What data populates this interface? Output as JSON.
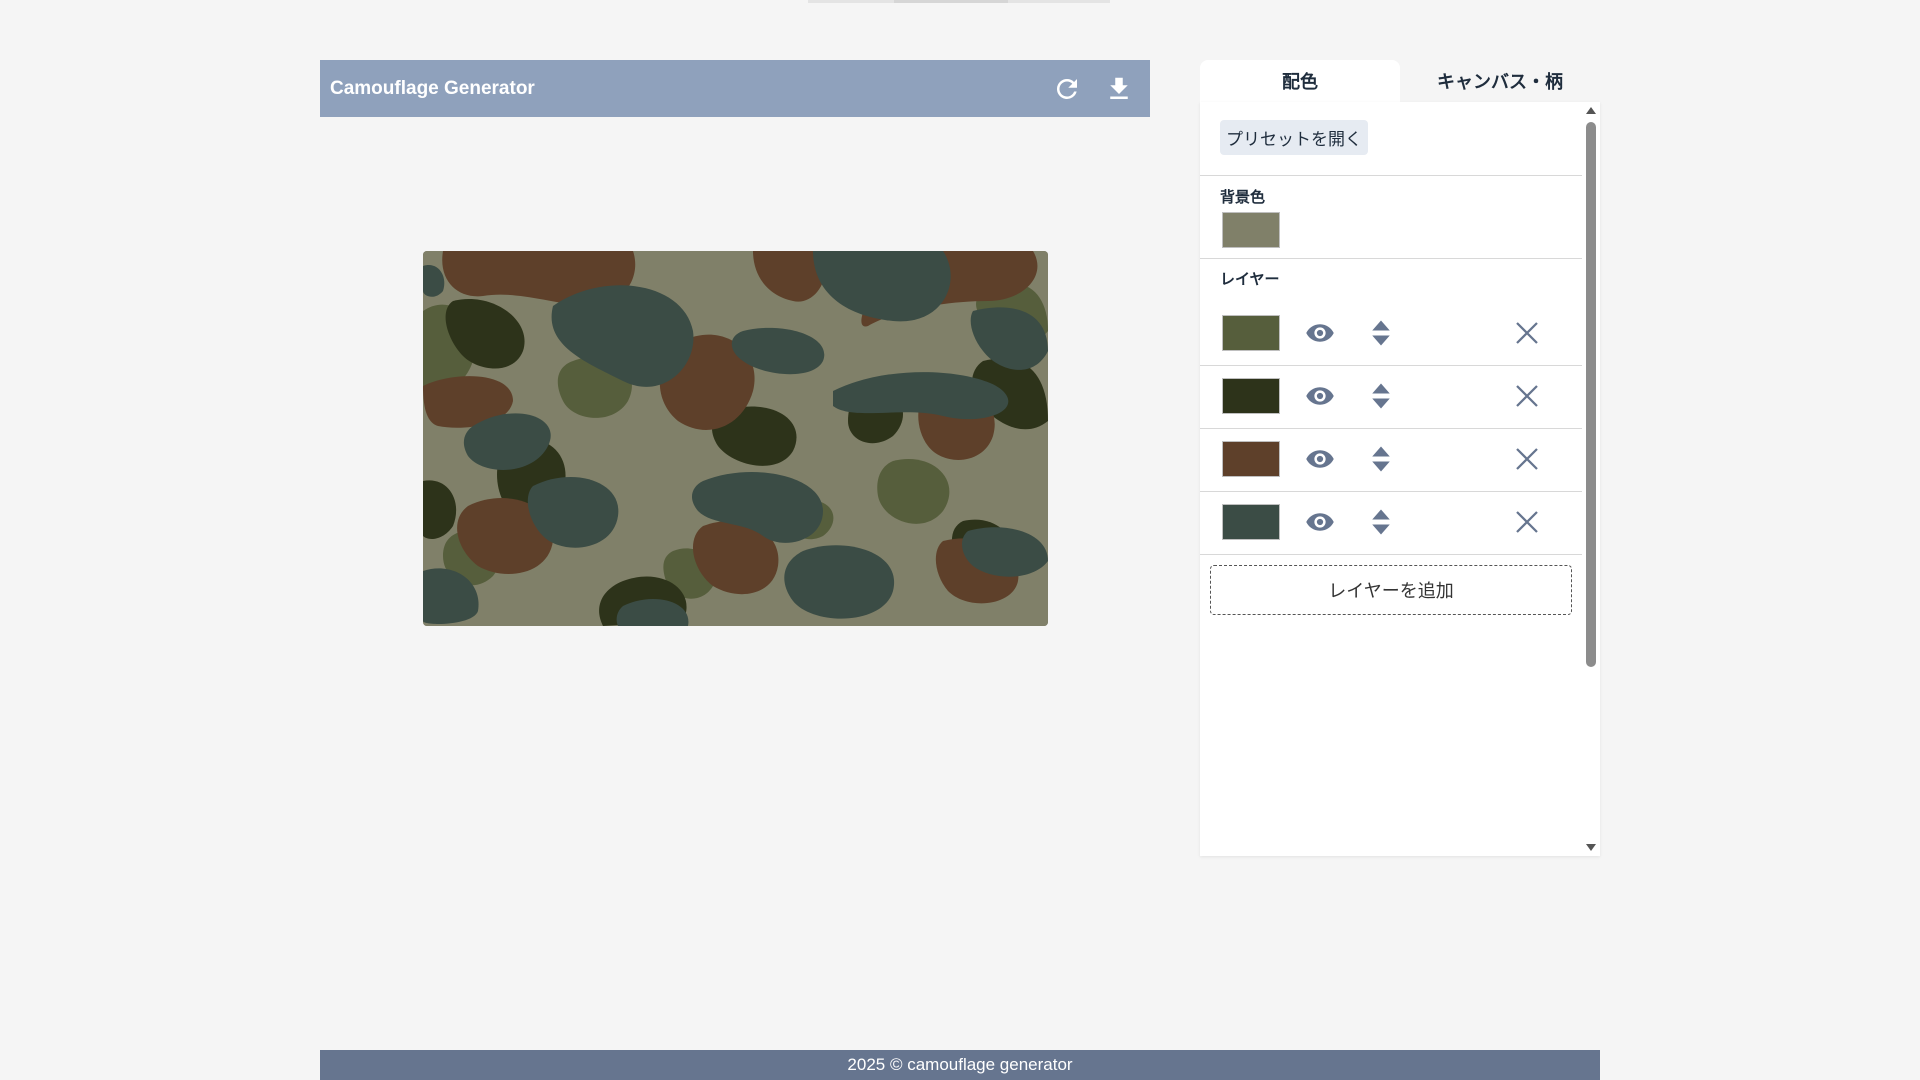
{
  "app": {
    "title": "Camouflage Generator"
  },
  "toolbar": {
    "regenerate_icon": "refresh-icon",
    "download_icon": "download-icon"
  },
  "tabs": [
    {
      "label": "配色",
      "active": true
    },
    {
      "label": "キャンバス・柄",
      "active": false
    }
  ],
  "color_panel": {
    "preset_button": "プリセットを開く",
    "background_label": "背景色",
    "background_color": "#808069",
    "layers_label": "レイヤー",
    "layers": [
      {
        "color": "#565e3c"
      },
      {
        "color": "#2d331a"
      },
      {
        "color": "#5e402a"
      },
      {
        "color": "#3b4c45"
      }
    ],
    "add_layer_button": "レイヤーを追加"
  },
  "colors": {
    "header_bg": "#8fa1bc",
    "footer_bg": "#66758f",
    "icon_color": "#66758f"
  },
  "footer": {
    "text": "2025 © camouflage generator"
  }
}
